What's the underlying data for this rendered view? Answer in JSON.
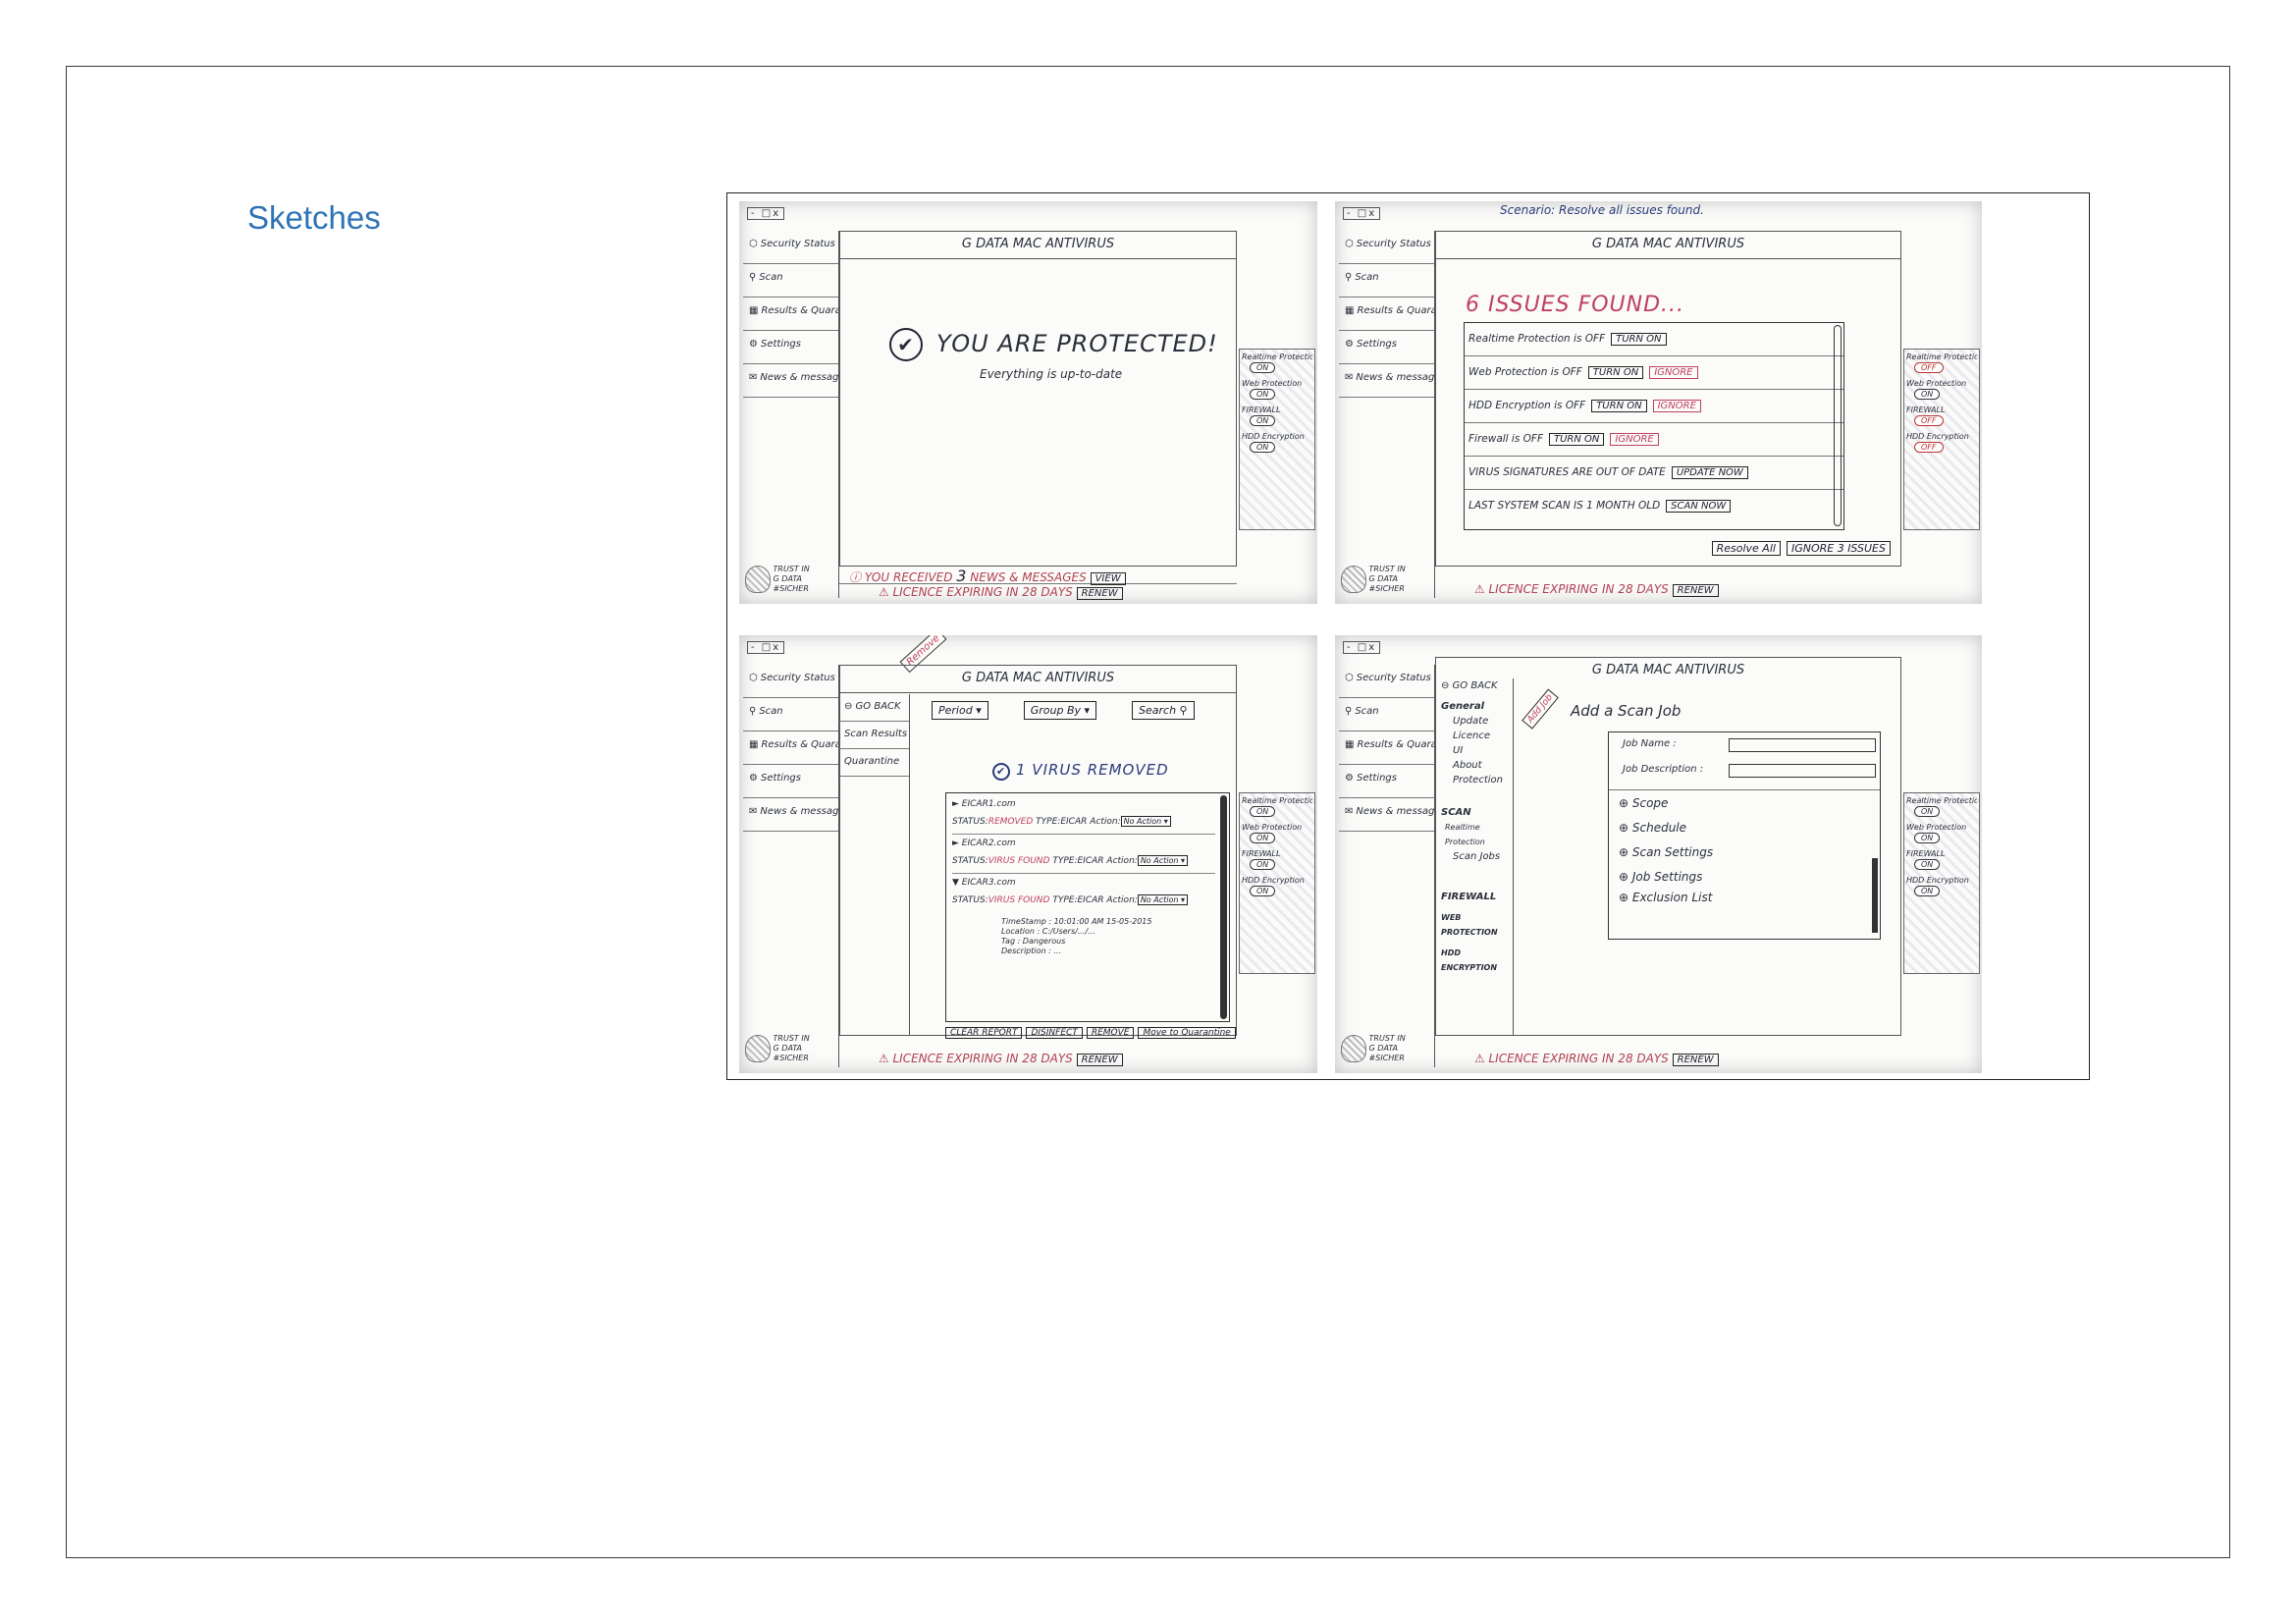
{
  "heading": "Sketches",
  "common": {
    "window_controls": "- □x",
    "nav": [
      {
        "icon": "shield-icon",
        "glyph": "⬡",
        "label": "Security Status"
      },
      {
        "icon": "search-icon",
        "glyph": "⚲",
        "label": "Scan"
      },
      {
        "icon": "report-icon",
        "glyph": "▦",
        "label": "Results & Quarantine"
      },
      {
        "icon": "gear-icon",
        "glyph": "⚙",
        "label": "Settings"
      },
      {
        "icon": "envelope-icon",
        "glyph": "✉",
        "label": "News & messages"
      }
    ],
    "logo_lines": [
      "TRUST IN",
      "G DATA",
      "#SICHER"
    ],
    "app_title": "G DATA MAC ANTIVIRUS",
    "panel": [
      {
        "label": "Realtime Protection",
        "state": "ON"
      },
      {
        "label": "Web Protection",
        "state": "ON"
      },
      {
        "label": "FIREWALL",
        "state": "ON"
      },
      {
        "label": "HDD Encryption",
        "state": "ON"
      }
    ],
    "license_text": "⚠ LICENCE EXPIRING IN 28 DAYS",
    "renew_label": "RENEW"
  },
  "sketch1": {
    "status_title": "YOU ARE PROTECTED!",
    "status_sub": "Everything is up-to-date",
    "messages_prefix": "ⓘ YOU RECEIVED",
    "messages_count": "3",
    "messages_suffix": "NEWS & MESSAGES",
    "view_label": "VIEW"
  },
  "sketch2": {
    "scenario": "Scenario: Resolve all issues found.",
    "issues_title": "6 ISSUES FOUND...",
    "issues": [
      {
        "text": "Realtime Protection is OFF",
        "action": "TURN ON",
        "ignore": ""
      },
      {
        "text": "Web Protection is OFF",
        "action": "TURN ON",
        "ignore": "IGNORE"
      },
      {
        "text": "HDD Encryption is OFF",
        "action": "TURN ON",
        "ignore": "IGNORE"
      },
      {
        "text": "Firewall is OFF",
        "action": "TURN ON",
        "ignore": "IGNORE"
      },
      {
        "text": "VIRUS SIGNATURES ARE OUT OF DATE",
        "action": "UPDATE NOW",
        "ignore": ""
      },
      {
        "text": "LAST SYSTEM SCAN IS 1 MONTH OLD",
        "action": "SCAN NOW",
        "ignore": ""
      }
    ],
    "resolve_all": "Resolve All",
    "ignore_issues": "IGNORE 3 ISSUES",
    "panel_states": [
      "OFF",
      "ON",
      "OFF",
      "OFF"
    ]
  },
  "sketch3": {
    "flag": "Remove",
    "subnav": [
      "⊖ GO BACK",
      "Scan Results",
      "Quarantine"
    ],
    "period": "Period ▾",
    "group_by": "Group By ▾",
    "search": "Search ⚲",
    "result_title": "1 VIRUS REMOVED",
    "viruses": [
      {
        "toggle": "►",
        "name": "EICAR1.com",
        "status": "REMOVED",
        "type": "EICAR",
        "action": "No Action ▾"
      },
      {
        "toggle": "►",
        "name": "EICAR2.com",
        "status": "VIRUS FOUND",
        "type": "EICAR",
        "action": "No Action ▾"
      },
      {
        "toggle": "▼",
        "name": "EICAR3.com",
        "status": "VIRUS FOUND",
        "type": "EICAR",
        "action": "No Action ▾"
      }
    ],
    "details": [
      "TimeStamp : 10:01:00 AM 15-05-2015",
      "Location : C:/Users/.../...",
      "Tag : Dangerous",
      "Description : ..."
    ],
    "status_label": "STATUS:",
    "type_label": "TYPE:",
    "action_label": "Action:",
    "buttons": [
      "CLEAR REPORT",
      "DISINFECT",
      "REMOVE",
      "Move to Quarantine"
    ]
  },
  "sketch4": {
    "go_back": "⊖ GO BACK",
    "general": "General",
    "general_items": [
      "Update",
      "Licence",
      "UI",
      "About",
      "Protection"
    ],
    "scan": "SCAN",
    "scan_items": [
      "Realtime Protection",
      "Scan Jobs"
    ],
    "extra": [
      "FIREWALL",
      "WEB PROTECTION",
      "HDD ENCRYPTION"
    ],
    "flag": "Add Job",
    "title": "Add a Scan Job",
    "job_name": "Job Name :",
    "job_description": "Job Description :",
    "options": [
      "⊕ Scope",
      "⊕ Schedule",
      "⊕ Scan Settings",
      "⊕ Job Settings",
      "⊕ Exclusion List"
    ]
  }
}
